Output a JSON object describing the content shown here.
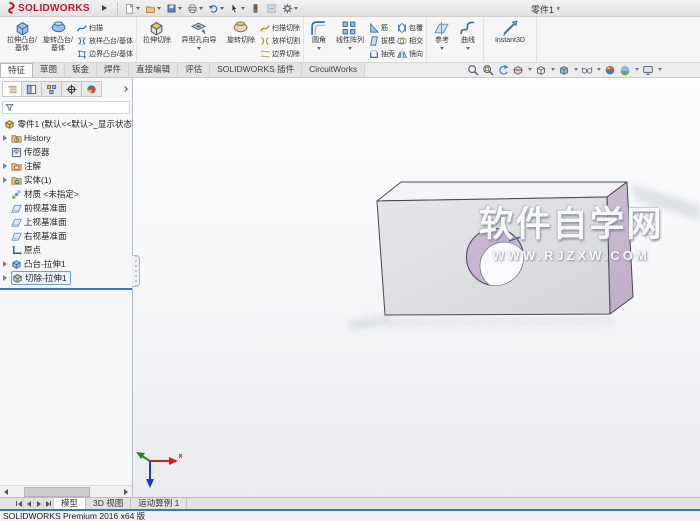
{
  "title_bar": {
    "logo_name": "SOLIDWORKS",
    "document_title": "零件1 *"
  },
  "quick_access_toolbar": {
    "icons": [
      "new-document",
      "open",
      "save",
      "print",
      "undo",
      "select",
      "rebuild",
      "file-properties",
      "options"
    ]
  },
  "ribbon": {
    "groups": [
      {
        "buttons": [
          {
            "label": "拉伸凸台/基体",
            "size": "large",
            "icon": "extruded-boss-base"
          },
          {
            "label": "旋转凸台/基体",
            "size": "large",
            "icon": "revolved-boss-base"
          },
          {
            "label": "扫描",
            "size": "small",
            "icon": "swept-boss-base"
          },
          {
            "label": "放样凸台/基体",
            "size": "small",
            "icon": "lofted-boss-base"
          },
          {
            "label": "边界凸台/基体",
            "size": "small",
            "icon": "boundary-boss-base"
          }
        ]
      },
      {
        "buttons": [
          {
            "label": "拉伸切除",
            "size": "large",
            "icon": "extruded-cut"
          },
          {
            "label": "异型孔向导",
            "size": "large",
            "icon": "hole-wizard",
            "dropdown": true
          },
          {
            "label": "旋转切除",
            "size": "large",
            "icon": "revolved-cut",
            "dropdown": true
          },
          {
            "label": "扫描切除",
            "size": "small",
            "icon": "swept-cut"
          },
          {
            "label": "放样切割",
            "size": "small",
            "icon": "lofted-cut"
          },
          {
            "label": "边界切除",
            "size": "small",
            "icon": "boundary-cut"
          }
        ]
      },
      {
        "buttons": [
          {
            "label": "圆角",
            "size": "large",
            "icon": "fillet",
            "dropdown": true
          },
          {
            "label": "线性阵列",
            "size": "large",
            "icon": "linear-pattern",
            "dropdown": true
          },
          {
            "label": "筋",
            "size": "small",
            "icon": "rib"
          },
          {
            "label": "拔模",
            "size": "small",
            "icon": "draft"
          },
          {
            "label": "抽壳",
            "size": "small",
            "icon": "shell"
          },
          {
            "label": "包覆",
            "size": "small",
            "icon": "wrap"
          },
          {
            "label": "相交",
            "size": "small",
            "icon": "intersect"
          },
          {
            "label": "镜向",
            "size": "small",
            "icon": "mirror"
          }
        ]
      },
      {
        "buttons": [
          {
            "label": "参考",
            "size": "large",
            "icon": "reference-geometry",
            "dropdown": true
          },
          {
            "label": "曲线",
            "size": "large",
            "icon": "curves",
            "dropdown": true
          }
        ]
      },
      {
        "buttons": [
          {
            "label": "Instant3D",
            "size": "large",
            "icon": "instant3d"
          }
        ]
      }
    ]
  },
  "command_tabs": {
    "tabs": [
      {
        "label": "特征",
        "active": true
      },
      {
        "label": "草图",
        "active": false
      },
      {
        "label": "钣金",
        "active": false
      },
      {
        "label": "焊件",
        "active": false
      },
      {
        "label": "直接编辑",
        "active": false
      },
      {
        "label": "评估",
        "active": false
      },
      {
        "label": "SOLIDWORKS 插件",
        "active": false
      },
      {
        "label": "CircuitWorks",
        "active": false
      }
    ]
  },
  "heads_up_toolbar": {
    "icons": [
      "zoom-to-fit",
      "zoom-to-area",
      "previous-view",
      "section-view",
      "view-orientation",
      "display-style",
      "hide-show-items",
      "edit-appearance",
      "apply-scene",
      "view-settings"
    ]
  },
  "feature_manager": {
    "panel_tabs": [
      "feature-manager-design-tree",
      "property-manager",
      "configuration-manager",
      "dimxpert-manager",
      "display-manager"
    ],
    "root_label": "零件1 (默认<<默认>_显示状态",
    "items": [
      {
        "label": "History",
        "icon": "history-folder",
        "expandable": true,
        "selected": false
      },
      {
        "label": "传感器",
        "icon": "sensors",
        "expandable": false,
        "selected": false
      },
      {
        "label": "注解",
        "icon": "annotations-folder",
        "expandable": true,
        "selected": false
      },
      {
        "label": "实体(1)",
        "icon": "solid-bodies-folder",
        "expandable": true,
        "selected": false
      },
      {
        "label": "材质 <未指定>",
        "icon": "material",
        "expandable": false,
        "selected": false
      },
      {
        "label": "前视基准面",
        "icon": "plane",
        "expandable": false,
        "selected": false
      },
      {
        "label": "上视基准面",
        "icon": "plane",
        "expandable": false,
        "selected": false
      },
      {
        "label": "右视基准面",
        "icon": "plane",
        "expandable": false,
        "selected": false
      },
      {
        "label": "原点",
        "icon": "origin",
        "expandable": false,
        "selected": false
      },
      {
        "label": "凸台-拉伸1",
        "icon": "boss-extrude",
        "expandable": true,
        "selected": false
      },
      {
        "label": "切除-拉伸1",
        "icon": "cut-extrude",
        "expandable": true,
        "selected": true
      }
    ]
  },
  "viewport": {
    "watermark_line1": "软件自学网",
    "watermark_line2": "WWW.RJZXW.COM",
    "triad_axes": [
      "x-red",
      "y-green",
      "z-blue"
    ]
  },
  "document_tabs": {
    "tabs": [
      {
        "label": "模型",
        "active": true
      },
      {
        "label": "3D 视图",
        "active": false
      },
      {
        "label": "运动算例 1",
        "active": false
      }
    ]
  },
  "status_bar": {
    "text": "SOLIDWORKS Premium 2016 x64 版"
  },
  "colors": {
    "logo_red": "#c8102e",
    "status_top_border": "#3877c8",
    "selection_border": "#68a0d8",
    "rollback_bar": "#4579bd",
    "model_front_face": "#dcdde0",
    "model_top_face": "#f4f4f7",
    "model_side_face": "#c7b3ce",
    "hole_inner": "#c9b5d2"
  }
}
